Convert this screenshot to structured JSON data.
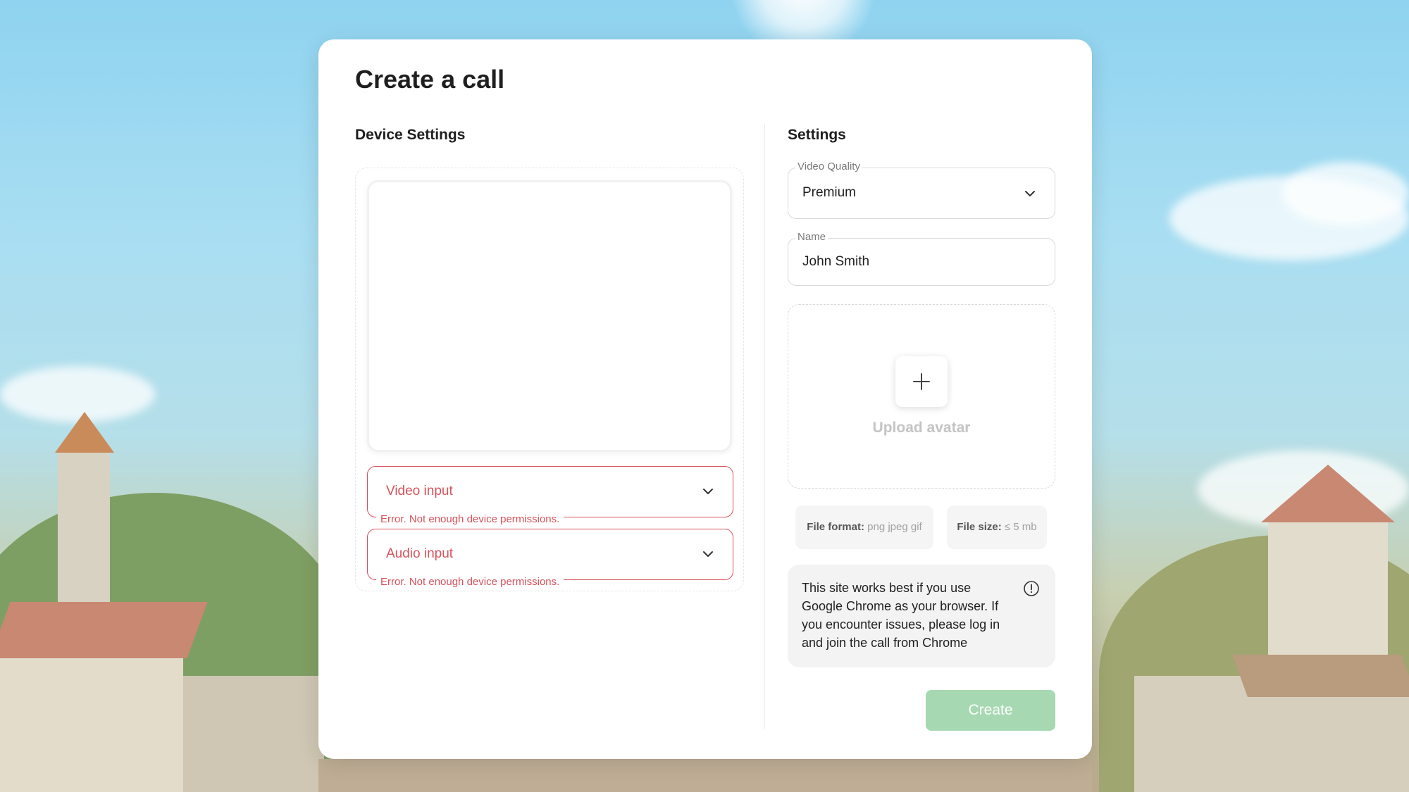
{
  "modal": {
    "title": "Create a call"
  },
  "device_settings": {
    "heading": "Device Settings",
    "video_input": {
      "label": "Video input",
      "error": "Error. Not enough device permissions."
    },
    "audio_input": {
      "label": "Audio input",
      "error": "Error. Not enough device permissions."
    }
  },
  "settings": {
    "heading": "Settings",
    "video_quality": {
      "legend": "Video Quality",
      "value": "Premium"
    },
    "name": {
      "legend": "Name",
      "value": "John Smith"
    },
    "upload_avatar_label": "Upload avatar",
    "file_format": {
      "label": "File format:",
      "value": "png jpeg gif"
    },
    "file_size": {
      "label": "File size:",
      "value": "≤ 5 mb"
    },
    "info_text": "This site works best if you use Google Chrome as your browser. If you encounter issues, please log in and join the call from Chrome",
    "create_label": "Create"
  },
  "colors": {
    "error": "#d6525b",
    "create_button": "#a6d8b2"
  }
}
